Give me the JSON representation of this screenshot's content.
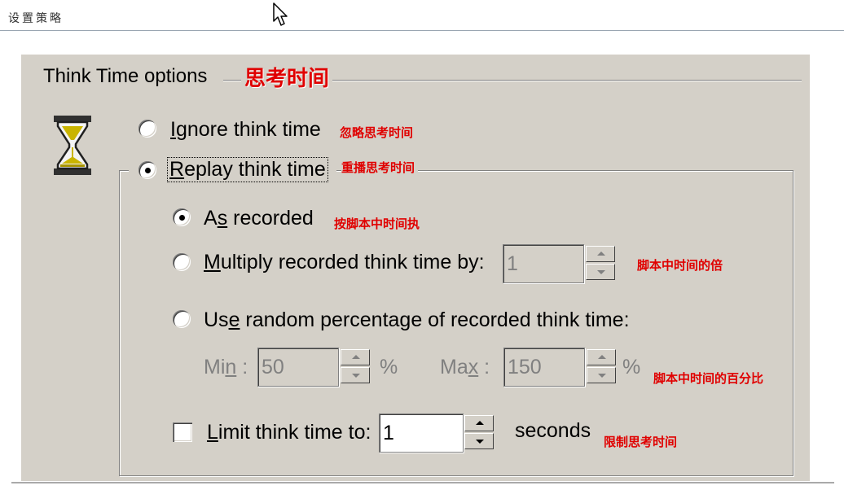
{
  "header": {
    "title": "设置策略"
  },
  "group": {
    "title": "Think Time options",
    "annotation": "思考时间"
  },
  "options": {
    "ignore": {
      "pre": "",
      "ul": "I",
      "post": "gnore think time",
      "annotation": "忽略思考时间",
      "selected": false
    },
    "replay": {
      "pre": "",
      "ul": "R",
      "post": "eplay think time",
      "annotation": "重播思考时间",
      "selected": true
    },
    "as_recorded": {
      "pre": "A",
      "ul": "s",
      "post": " recorded",
      "annotation": "按脚本中时间执",
      "selected": true
    },
    "multiply": {
      "pre": "",
      "ul": "M",
      "post": "ultiply recorded think time by:",
      "annotation": "脚本中时间的倍",
      "value": "1",
      "selected": false
    },
    "random": {
      "pre": "Us",
      "ul": "e",
      "post": " random percentage of recorded think time:",
      "annotation": "脚本中时间的百分比",
      "selected": false,
      "min_label_pre": "Mi",
      "min_label_ul": "n",
      "min_label_post": " :",
      "min_value": "50",
      "min_unit": "%",
      "max_label_pre": "Ma",
      "max_label_ul": "x",
      "max_label_post": " :",
      "max_value": "150",
      "max_unit": "%"
    },
    "limit": {
      "pre": "",
      "ul": "L",
      "post": "imit think time to:",
      "value": "1",
      "unit": "seconds",
      "annotation": "限制思考时间",
      "checked": false
    }
  },
  "icons": {
    "hourglass": "hourglass-icon",
    "cursor": "mouse-pointer-icon"
  },
  "colors": {
    "panel": "#d4d0c8",
    "annotation": "#e00000",
    "disabled_text": "#808080"
  }
}
